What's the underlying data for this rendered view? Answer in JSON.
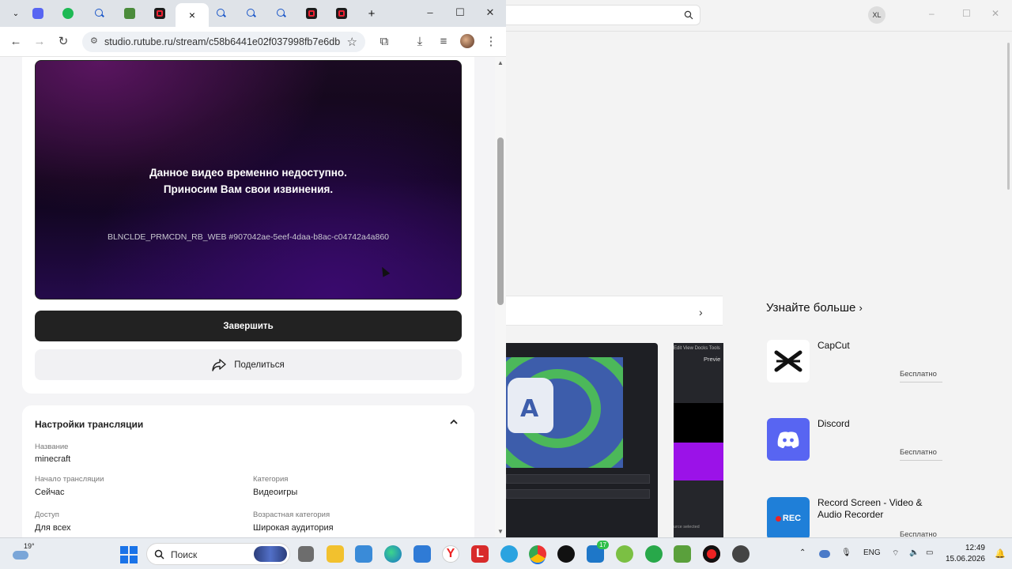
{
  "browser": {
    "url": "studio.rutube.ru/stream/c58b6441e02f037998fb7e6db6...",
    "tab_close": "×",
    "new_tab": "+"
  },
  "player": {
    "message_line1": "Данное видео временно недоступно.",
    "message_line2": "Приносим Вам свои извинения.",
    "error_code": "BLNCLDE_PRMCDN_RB_WEB #907042ae-5eef-4daa-b8ac-c04742a4a860"
  },
  "actions": {
    "finish_label": "Завершить",
    "share_label": "Поделиться"
  },
  "settings": {
    "title": "Настройки трансляции",
    "fields": [
      {
        "label": "Название",
        "value": "minecraft"
      },
      {
        "label": "Начало трансляции",
        "value": "Сейчас"
      },
      {
        "label": "Категория",
        "value": "Видеоигры"
      },
      {
        "label": "Доступ",
        "value": "Для всех"
      },
      {
        "label": "Возрастная категория",
        "value": "Широкая аудитория"
      }
    ]
  },
  "store": {
    "account_badge": "XL",
    "learn_more": "Узнайте больше",
    "apps": [
      {
        "name": "CapCut",
        "price": "Бесплатно"
      },
      {
        "name": "Discord",
        "price": "Бесплатно"
      },
      {
        "name": "Record Screen - Video & Audio Recorder",
        "price": "Бесплатно",
        "icon_text": "REC"
      }
    ],
    "preview_menu": "Edit  View  Docks  Tools",
    "preview_label": "Previe",
    "source_label": "urce selected"
  },
  "taskbar": {
    "weather": "19°",
    "search_placeholder": "Поиск",
    "language": "ENG",
    "time": "12:49",
    "date": "15.06.2026",
    "badge_count": "17",
    "letter_app": "L"
  }
}
